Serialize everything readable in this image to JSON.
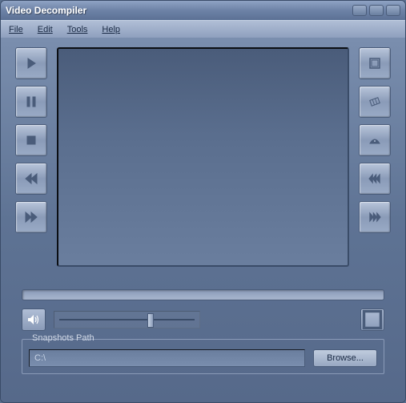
{
  "window": {
    "title": "Video Decompiler"
  },
  "menu": {
    "file": "File",
    "edit": "Edit",
    "tools": "Tools",
    "help": "Help"
  },
  "controls": {
    "play": "play-icon",
    "pause": "pause-icon",
    "stop": "stop-icon",
    "rewind": "rewind-icon",
    "fast_forward": "fast-forward-icon",
    "image_capture": "image-capture-icon",
    "film_capture": "film-capture-icon",
    "grab_range": "grab-range-icon",
    "skip_back": "skip-back-icon",
    "skip_forward": "skip-forward-icon"
  },
  "volume": {
    "slider_percent": 55
  },
  "snapshots": {
    "legend": "Snapshots Path",
    "path_value": "C:\\",
    "browse_label": "Browse..."
  },
  "colors": {
    "accent_light": "#b0bed6",
    "accent_dark": "#5a6f8f",
    "icon_fill": "#4a5c7a"
  }
}
